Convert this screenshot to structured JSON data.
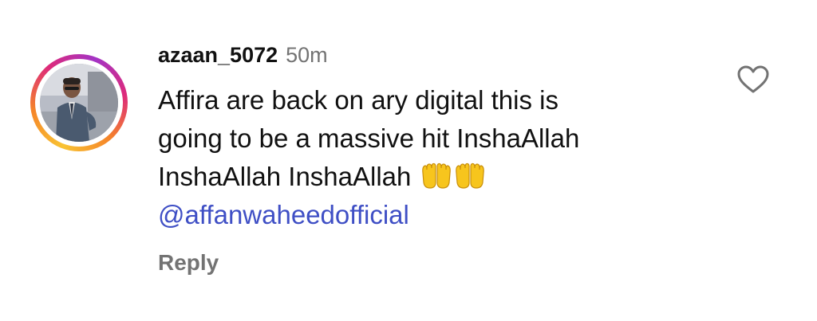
{
  "comment": {
    "username": "azaan_5072",
    "time": "50m",
    "text_lines": [
      "Affira are back on ary digital this is",
      "going to be a massive hit InshaAllah",
      "InshaAllah InshaAllah"
    ],
    "emoji": [
      "open-hands-emoji",
      "open-hands-emoji"
    ],
    "mention": "@affanwaheedofficial",
    "reply_label": "Reply"
  },
  "icons": {
    "like": "heart-outline-icon",
    "avatar_ring": "story-ring"
  },
  "colors": {
    "username": "#111111",
    "meta_gray": "#737373",
    "mention_blue": "#3f4fc5",
    "ring_gradient": [
      "#f9c333",
      "#f58529",
      "#dd2a7b",
      "#a334c5"
    ],
    "emoji_yellow": "#f7c51d"
  }
}
